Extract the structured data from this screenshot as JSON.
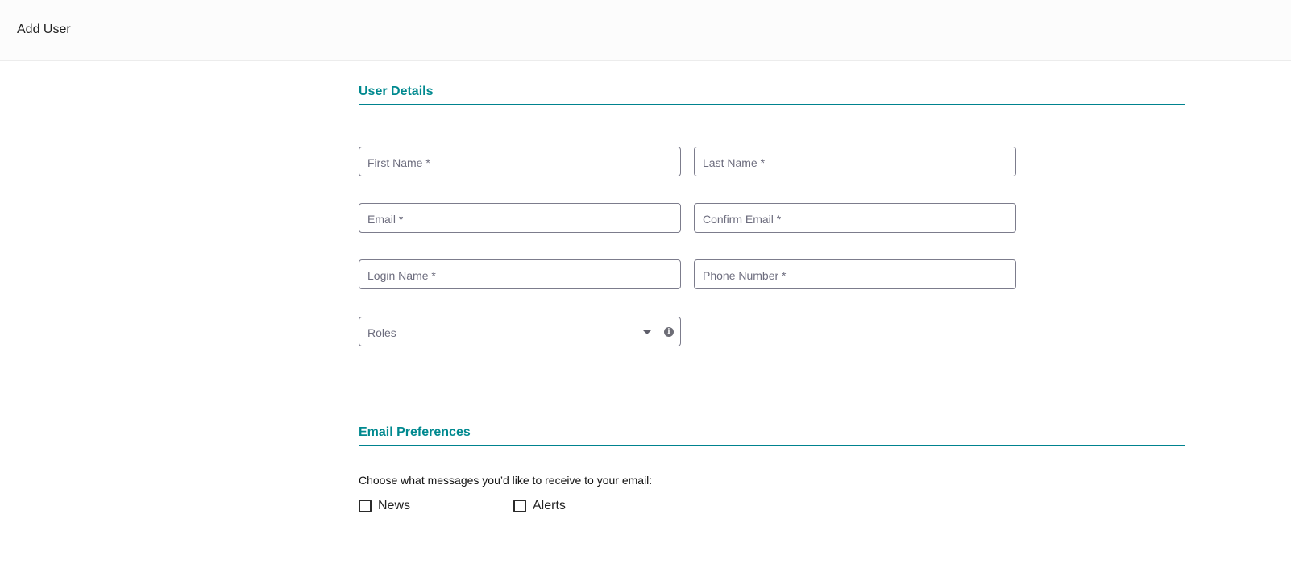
{
  "header": {
    "title": "Add User"
  },
  "user_details": {
    "heading": "User Details",
    "fields": {
      "first_name": {
        "placeholder": "First Name *",
        "value": ""
      },
      "last_name": {
        "placeholder": "Last Name *",
        "value": ""
      },
      "email": {
        "placeholder": "Email *",
        "value": ""
      },
      "confirm_email": {
        "placeholder": "Confirm Email *",
        "value": ""
      },
      "login_name": {
        "placeholder": "Login Name *",
        "value": ""
      },
      "phone_number": {
        "placeholder": "Phone Number *",
        "value": ""
      }
    },
    "roles": {
      "label": "Roles",
      "icons": [
        "chevron-down-icon",
        "info-icon"
      ]
    }
  },
  "email_preferences": {
    "heading": "Email Preferences",
    "description": "Choose what messages you’d like to receive to your email:",
    "options": [
      {
        "label": "News",
        "checked": false
      },
      {
        "label": "Alerts",
        "checked": false
      }
    ]
  },
  "colors": {
    "accent": "#00898f",
    "field_border": "#7c7c8c",
    "placeholder": "#6d6d7e"
  }
}
